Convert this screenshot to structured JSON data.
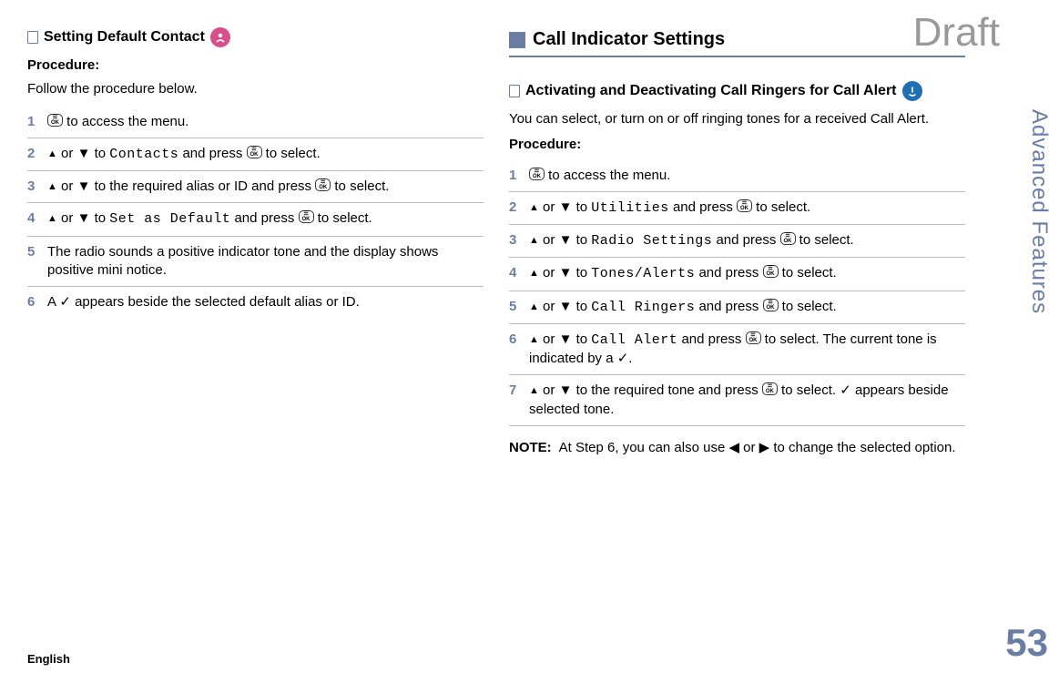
{
  "watermark": "Draft",
  "sidebar_label": "Advanced Features",
  "page_number": "53",
  "language": "English",
  "left": {
    "heading": "Setting Default Contact",
    "procedure_label": "Procedure:",
    "intro": "Follow the procedure below.",
    "steps": [
      {
        "n": "1",
        "pre": "",
        "post": " to access the menu.",
        "ok_first": true
      },
      {
        "n": "2",
        "text_before_mono": " or ▼ to ",
        "mono": "Contacts",
        "text_after_mono": " and press ",
        "tail": " to select."
      },
      {
        "n": "3",
        "text": " or ▼ to the required alias or ID and press ",
        "tail": " to select."
      },
      {
        "n": "4",
        "text_before_mono": " or ▼ to ",
        "mono": "Set as Default",
        "text_after_mono": " and press ",
        "tail": " to select."
      },
      {
        "n": "5",
        "plain": "The radio sounds a positive indicator tone and the display shows positive mini notice."
      },
      {
        "n": "6",
        "plain": "A ✓ appears beside the selected default alias or ID."
      }
    ]
  },
  "right": {
    "major_heading": "Call Indicator Settings",
    "sub_heading": "Activating and Deactivating Call Ringers for Call Alert",
    "intro": "You can select, or turn on or off ringing tones for a received Call Alert.",
    "procedure_label": "Procedure:",
    "steps": [
      {
        "n": "1",
        "post": " to access the menu.",
        "ok_first": true
      },
      {
        "n": "2",
        "text_before_mono": " or ▼ to ",
        "mono": "Utilities",
        "text_after_mono": " and press ",
        "tail": " to select."
      },
      {
        "n": "3",
        "text_before_mono": " or ▼ to ",
        "mono": "Radio Settings",
        "text_after_mono": " and press ",
        "tail": " to select."
      },
      {
        "n": "4",
        "text_before_mono": " or ▼ to ",
        "mono": "Tones/Alerts",
        "text_after_mono": " and press ",
        "tail": " to select."
      },
      {
        "n": "5",
        "text_before_mono": " or ▼ to ",
        "mono": "Call Ringers",
        "text_after_mono": " and press ",
        "tail": " to select."
      },
      {
        "n": "6",
        "text_before_mono": " or ▼ to ",
        "mono": "Call Alert",
        "text_after_mono": " and press ",
        "tail": " to select. The current tone is indicated by a ✓."
      },
      {
        "n": "7",
        "text": " or ▼ to the required tone and press ",
        "tail": " to select. ✓ appears beside selected tone."
      }
    ],
    "note_label": "NOTE:",
    "note_text": "At Step 6, you can also use ◀ or ▶ to change the selected option."
  }
}
